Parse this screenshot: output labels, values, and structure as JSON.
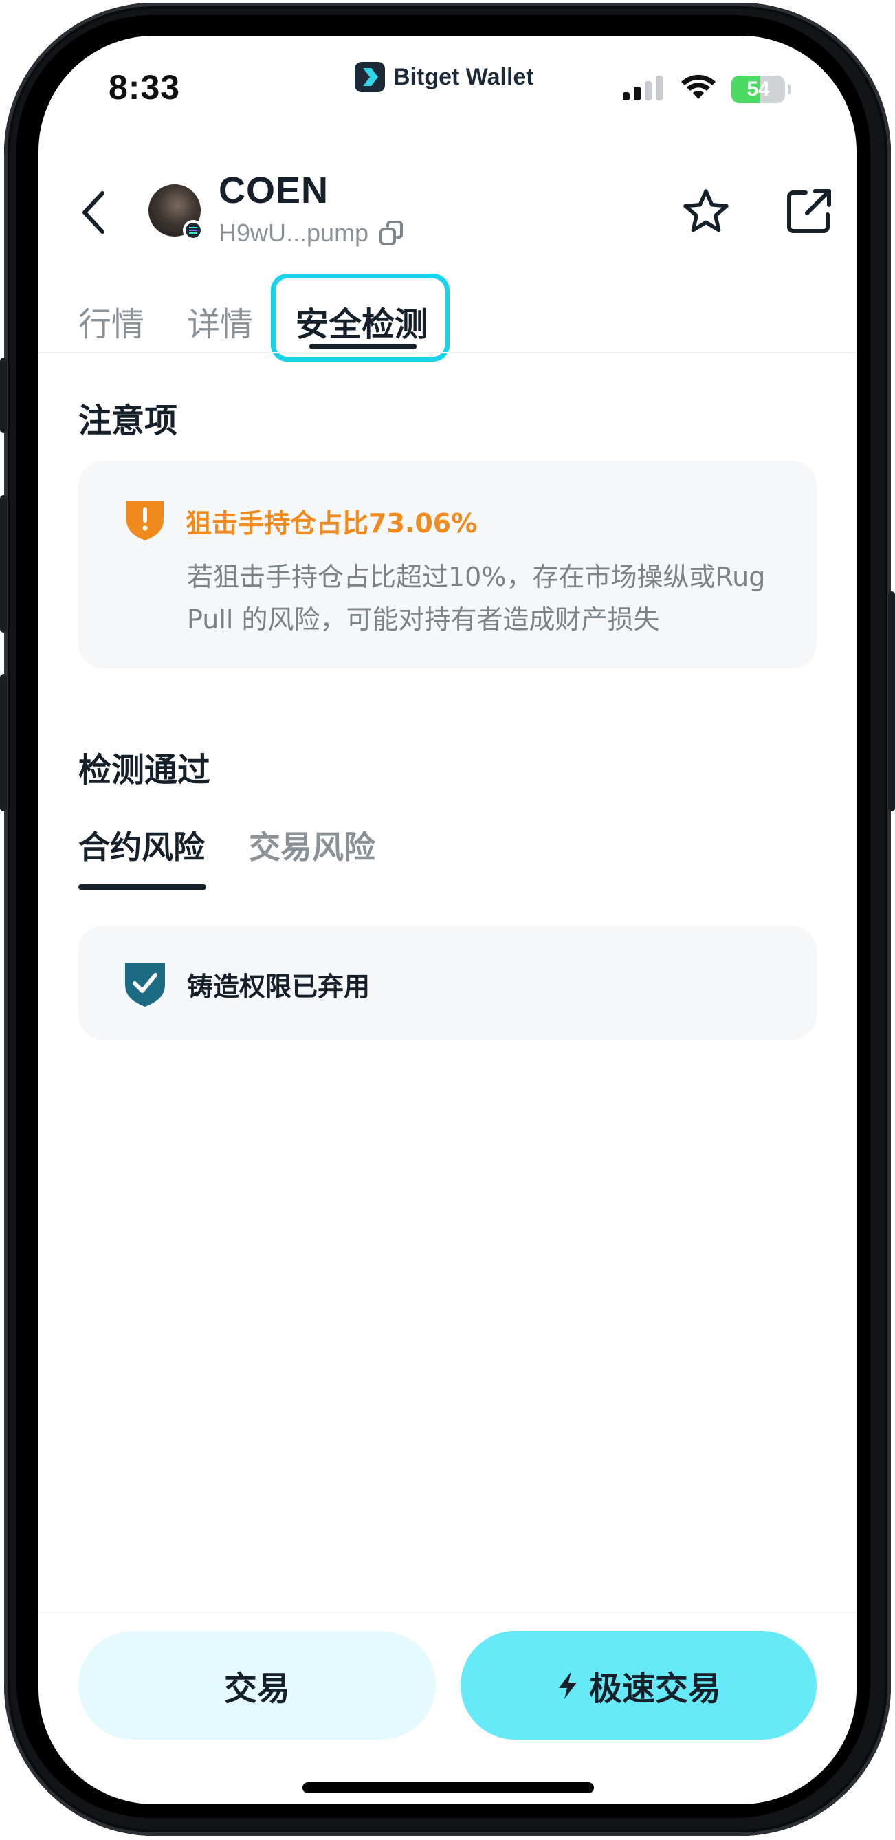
{
  "status_bar": {
    "time": "8:33",
    "brand": "Bitget Wallet",
    "battery_percent": "54",
    "battery_level": 0.54,
    "signal_icon": "cellular-signal-icon",
    "wifi_icon": "wifi-icon"
  },
  "header": {
    "token_name": "COEN",
    "address": "H9wU...pump",
    "back_icon": "chevron-left-icon",
    "copy_icon": "copy-icon",
    "favorite_icon": "star-icon",
    "share_icon": "share-icon"
  },
  "tabs": [
    {
      "label": "行情",
      "active": false
    },
    {
      "label": "详情",
      "active": false
    },
    {
      "label": "安全检测",
      "active": true
    }
  ],
  "notice": {
    "title": "注意项",
    "warning_title": "狙击手持仓占比73.06%",
    "warning_desc": "若狙击手持仓占比超过10%，存在市场操纵或Rug Pull 的风险，可能对持有者造成财产损失"
  },
  "passed": {
    "title": "检测通过",
    "subtabs": [
      {
        "label": "合约风险",
        "active": true
      },
      {
        "label": "交易风险",
        "active": false
      }
    ],
    "items": [
      {
        "label": "铸造权限已弃用"
      }
    ]
  },
  "actions": {
    "trade_label": "交易",
    "fast_trade_label": "极速交易"
  },
  "colors": {
    "accent_cyan": "#66eaf7",
    "light_cyan": "#e5fafe",
    "warning_orange": "#f18a1c",
    "shield_teal": "#1d6b82",
    "highlight": "#17d4ea"
  }
}
